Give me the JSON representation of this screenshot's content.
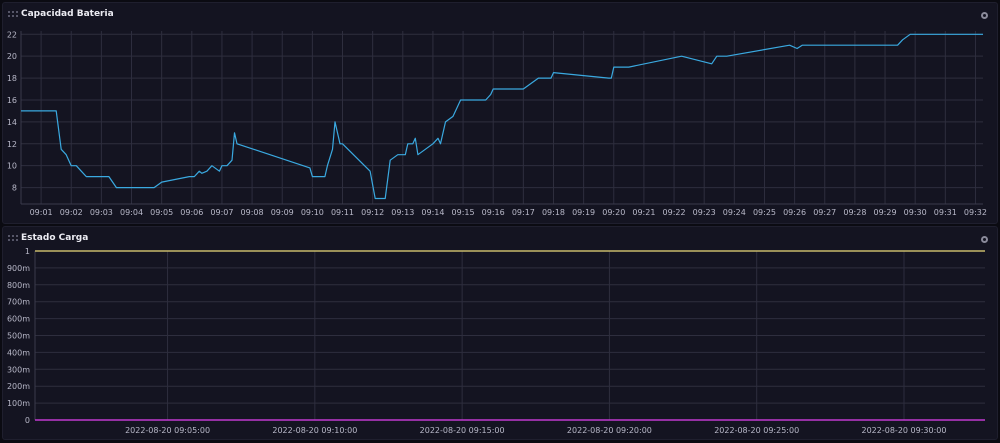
{
  "panels": [
    {
      "title": "Capacidad Bateria"
    },
    {
      "title": "Estado Carga"
    }
  ],
  "icons": [
    "drag-handle-icon",
    "gear-icon"
  ],
  "colors": {
    "background": "#141421",
    "grid": "#2e2e3e",
    "series1": "#3aa9e0",
    "series2_high": "#c7b96a",
    "series2_low": "#c03ad0"
  },
  "chart_data": [
    {
      "type": "line",
      "title": "Capacidad Bateria",
      "ylim": [
        6.5,
        22.3
      ],
      "yticks": [
        8,
        10,
        12,
        14,
        16,
        18,
        20,
        22
      ],
      "xlim": [
        "09:00:20",
        "09:32:15"
      ],
      "xticks": [
        "09:01",
        "09:02",
        "09:03",
        "09:04",
        "09:05",
        "09:06",
        "09:07",
        "09:08",
        "09:09",
        "09:10",
        "09:11",
        "09:12",
        "09:13",
        "09:14",
        "09:15",
        "09:16",
        "09:17",
        "09:18",
        "09:19",
        "09:20",
        "09:21",
        "09:22",
        "09:23",
        "09:24",
        "09:25",
        "09:26",
        "09:27",
        "09:28",
        "09:29",
        "09:30",
        "09:31",
        "09:32"
      ],
      "grid": true,
      "series": [
        {
          "x": [
            "09:00:20",
            "09:01:30",
            "09:01:40",
            "09:01:50",
            "09:02:00",
            "09:02:10",
            "09:02:20",
            "09:02:30",
            "09:03:15",
            "09:03:30",
            "09:04:45",
            "09:05:00",
            "09:05:55",
            "09:06:05",
            "09:06:15",
            "09:06:20",
            "09:06:30",
            "09:06:40",
            "09:06:55",
            "09:07:00",
            "09:07:10",
            "09:07:20",
            "09:07:25",
            "09:07:30",
            "09:09:55",
            "09:10:00",
            "09:10:10",
            "09:10:15",
            "09:10:25",
            "09:10:30",
            "09:10:40",
            "09:10:45",
            "09:10:55",
            "09:11:00",
            "09:11:55",
            "09:12:05",
            "09:12:15",
            "09:12:25",
            "09:12:35",
            "09:12:50",
            "09:13:05",
            "09:13:10",
            "09:13:20",
            "09:13:25",
            "09:13:30",
            "09:14:00",
            "09:14:10",
            "09:14:15",
            "09:14:25",
            "09:14:40",
            "09:14:55",
            "09:15:35",
            "09:15:45",
            "09:15:55",
            "09:16:00",
            "09:16:50",
            "09:17:00",
            "09:17:30",
            "09:17:55",
            "09:18:00",
            "09:19:50",
            "09:19:55",
            "09:20:00",
            "09:20:10",
            "09:20:20",
            "09:20:30",
            "09:22:15",
            "09:23:15",
            "09:23:25",
            "09:23:35",
            "09:23:45",
            "09:25:50",
            "09:26:05",
            "09:26:15",
            "09:26:25",
            "09:26:30",
            "09:29:25",
            "09:29:35",
            "09:29:50",
            "09:32:15"
          ],
          "values": [
            15,
            15,
            11.5,
            11,
            10,
            10,
            9.5,
            9,
            9,
            8,
            8,
            8.5,
            9,
            9,
            9.5,
            9.3,
            9.5,
            10,
            9.5,
            10,
            10,
            10.5,
            13,
            12,
            9.8,
            9,
            9,
            9,
            9,
            10,
            11.5,
            14,
            12,
            12,
            9.5,
            7,
            7,
            7,
            10.5,
            11,
            11,
            12,
            12,
            12.5,
            11,
            12,
            12.5,
            12,
            14,
            14.5,
            16,
            16,
            16,
            16.5,
            17,
            17,
            17,
            18,
            18,
            18.5,
            18,
            18,
            19,
            19,
            19,
            19,
            20,
            19.3,
            20,
            20,
            20,
            21,
            20.7,
            21,
            21,
            21,
            21,
            21.5,
            22,
            22
          ]
        }
      ]
    },
    {
      "type": "line",
      "title": "Estado Carga",
      "ylim": [
        0,
        1
      ],
      "yticks": [
        "0",
        "100m",
        "200m",
        "300m",
        "400m",
        "500m",
        "600m",
        "700m",
        "800m",
        "900m",
        "1"
      ],
      "xlim": [
        "2022-08-20 09:00:30",
        "2022-08-20 09:32:45"
      ],
      "xticks": [
        "2022-08-20 09:05:00",
        "2022-08-20 09:10:00",
        "2022-08-20 09:15:00",
        "2022-08-20 09:20:00",
        "2022-08-20 09:25:00",
        "2022-08-20 09:30:00"
      ],
      "grid": true,
      "series": [
        {
          "x": [
            "2022-08-20 09:00:30",
            "2022-08-20 09:32:45"
          ],
          "values": [
            1,
            1
          ]
        },
        {
          "x": [
            "2022-08-20 09:00:30",
            "2022-08-20 09:32:45"
          ],
          "values": [
            0,
            0
          ]
        }
      ]
    }
  ]
}
